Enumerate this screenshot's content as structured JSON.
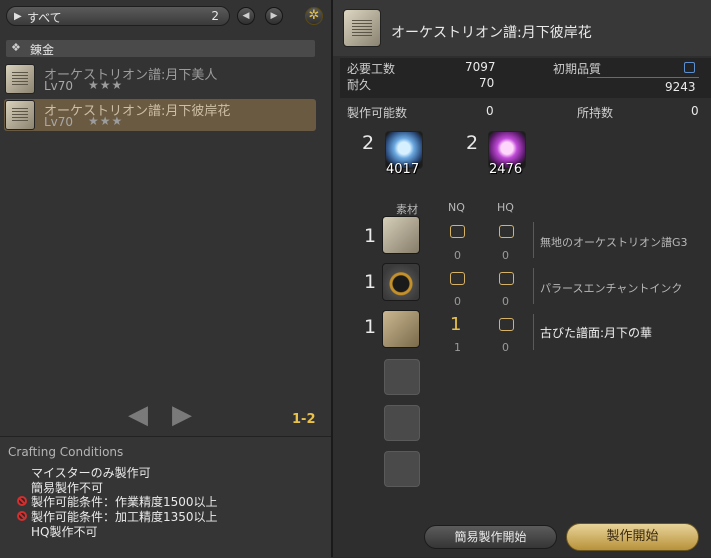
{
  "filter": {
    "label": "すべて",
    "count": "2"
  },
  "category": "錬金",
  "recipes": [
    {
      "name": "オーケストリオン譜:月下美人",
      "level": "Lv70",
      "stars": "★★★"
    },
    {
      "name": "オーケストリオン譜:月下彼岸花",
      "level": "Lv70",
      "stars": "★★★"
    }
  ],
  "page": "1-2",
  "conditions": {
    "title": "Crafting Conditions",
    "lines": [
      "マイスターのみ製作可",
      "簡易製作不可",
      "製作可能条件：作業精度1500以上",
      "製作可能条件：加工精度1350以上",
      "HQ製作不可"
    ]
  },
  "detail": {
    "title": "オーケストリオン譜:月下彼岸花",
    "difficulty_label": "必要工数",
    "difficulty": "7097",
    "durability_label": "耐久",
    "durability": "70",
    "quality_label": "初期品質",
    "quality_max": "9243",
    "craftable_label": "製作可能数",
    "craftable": "0",
    "owned_label": "所持数",
    "owned": "0"
  },
  "crystals": [
    {
      "qty": "2",
      "have": "4017",
      "icon": "wind-crystal-icon"
    },
    {
      "qty": "2",
      "have": "2476",
      "icon": "lightning-crystal-icon"
    }
  ],
  "material_headers": {
    "material": "素材",
    "nq": "NQ",
    "hq": "HQ"
  },
  "materials": [
    {
      "qty": "1",
      "nq": "",
      "hq": "",
      "nq_have": "0",
      "hq_have": "0",
      "name": "無地のオーケストリオン譜G3"
    },
    {
      "qty": "1",
      "nq": "",
      "hq": "",
      "nq_have": "0",
      "hq_have": "0",
      "name": "パラースエンチャントインク"
    },
    {
      "qty": "1",
      "nq": "1",
      "hq": "",
      "nq_have": "1",
      "hq_have": "0",
      "name": "古びた譜面:月下の華"
    }
  ],
  "buttons": {
    "quick_synth": "簡易製作開始",
    "synthesize": "製作開始"
  }
}
